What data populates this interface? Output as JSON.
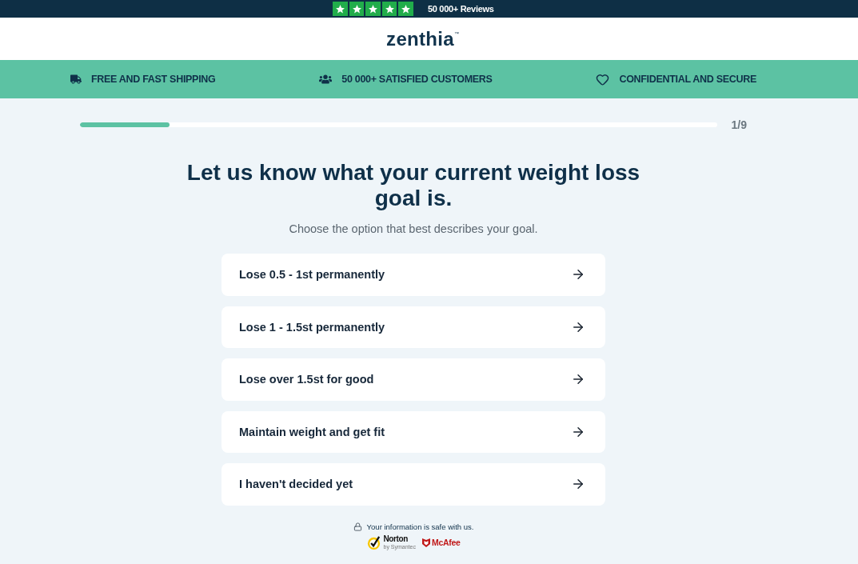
{
  "reviews": {
    "stars": 5,
    "text": "50 000+ Reviews"
  },
  "logo": {
    "name": "zenthia",
    "mark": "™"
  },
  "benefits": [
    {
      "kind": "shipping",
      "label": "FREE AND FAST SHIPPING"
    },
    {
      "kind": "customers",
      "label": "50 000+ SATISFIED CUSTOMERS"
    },
    {
      "kind": "privacy",
      "label": "CONFIDENTIAL AND SECURE"
    }
  ],
  "progress": {
    "level": 0.14,
    "step": "1/9"
  },
  "question": {
    "title": "Let us know what your current weight loss goal is.",
    "subtitle": "Choose the option that best describes your goal."
  },
  "options": [
    "Lose 0.5 - 1st permanently",
    "Lose 1 - 1.5st permanently",
    "Lose over 1.5st for good",
    "Maintain weight and get fit",
    "I haven't decided yet"
  ],
  "security_note": "Your information is safe with us.",
  "trust_badges": [
    {
      "kind": "norton",
      "name": "Norton",
      "byline": "by Symantec"
    },
    {
      "kind": "mcafee",
      "name": "McAfee"
    }
  ]
}
